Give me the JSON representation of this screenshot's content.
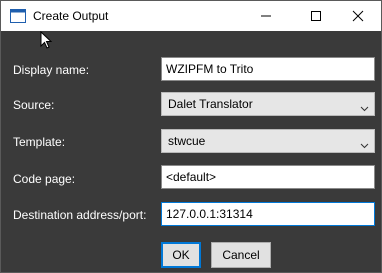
{
  "window": {
    "title": "Create Output",
    "controls": {
      "minimize": "minimize",
      "maximize": "maximize",
      "close": "close"
    }
  },
  "form": {
    "display_name": {
      "label": "Display name:",
      "value": "WZIPFM to Trito"
    },
    "source": {
      "label": "Source:",
      "value": "Dalet Translator"
    },
    "template": {
      "label": "Template:",
      "value": "stwcue"
    },
    "code_page": {
      "label": "Code page:",
      "value": "<default>"
    },
    "destination": {
      "label": "Destination address/port:",
      "value": "127.0.0.1:31314"
    }
  },
  "buttons": {
    "ok": "OK",
    "cancel": "Cancel"
  },
  "colors": {
    "background": "#3a3a3a",
    "accent": "#0078d7",
    "label_text": "#ffffff"
  }
}
